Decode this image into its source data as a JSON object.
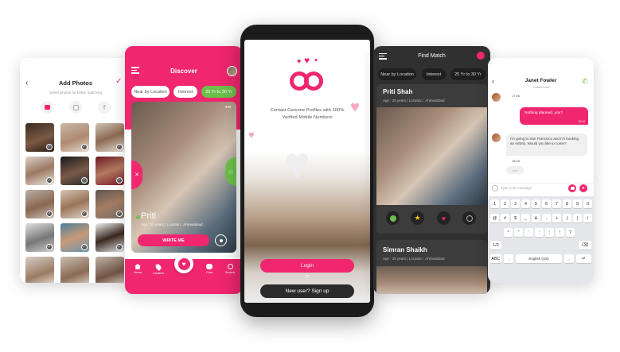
{
  "colors": {
    "accent": "#f0266f",
    "dark": "#2b2b2b",
    "green": "#6cc04a"
  },
  "add_photos": {
    "title": "Add Photos",
    "subtitle": "Select photos for better matching"
  },
  "discover": {
    "title": "Discover",
    "filters": [
      "Near by Location",
      "Interest",
      "25 Yr to 30 Yr"
    ],
    "profile_name": "Priti",
    "profile_meta": "Age : 25 years  |  Location : Ahmedabad",
    "write_btn": "WRITE ME",
    "nav": [
      "Home",
      "Location",
      "Chat",
      "Search"
    ]
  },
  "welcome": {
    "tagline_line1": "Contact Genuine Profiles with 100%",
    "tagline_line2": "Verified Mobile Numbers",
    "login": "Login",
    "or": "or",
    "signup": "New user? Sign up"
  },
  "find_match": {
    "title": "Find Match",
    "filters": [
      "Near by Location",
      "Interest",
      "25 Yr to 30 Yr"
    ],
    "card1_name": "Priti Shah",
    "card1_meta": "Age : 25 years  |  Location : Ahmedabad",
    "card2_name": "Simran Shaikh",
    "card2_meta": "Age : 25 years  |  Location : Ahmedabad"
  },
  "chat": {
    "contact": "Janet Fowler",
    "status": "Online now",
    "time1": "17:56",
    "msg_out": "Nothing planned, you?",
    "msg_out_time": "18:04",
    "msg_in": "I'm going to San Francisco and I'm booking an Airbnb. Would you like to come?",
    "msg_in_time": "18:05",
    "typing": "• • •",
    "placeholder": "Type your message",
    "keyboard_rows": [
      [
        "1",
        "2",
        "3",
        "4",
        "5",
        "6",
        "7",
        "8",
        "9",
        "0"
      ],
      [
        "@",
        "#",
        "$",
        "_",
        "&",
        "-",
        "+",
        "(",
        ")",
        "/"
      ],
      [
        "*",
        "\"",
        "'",
        ":",
        ";",
        "!",
        "?"
      ]
    ],
    "key_12": "1/2",
    "key_abc": "ABC",
    "key_lang": "English (US)",
    "key_comma": ",",
    "key_dot": "."
  }
}
